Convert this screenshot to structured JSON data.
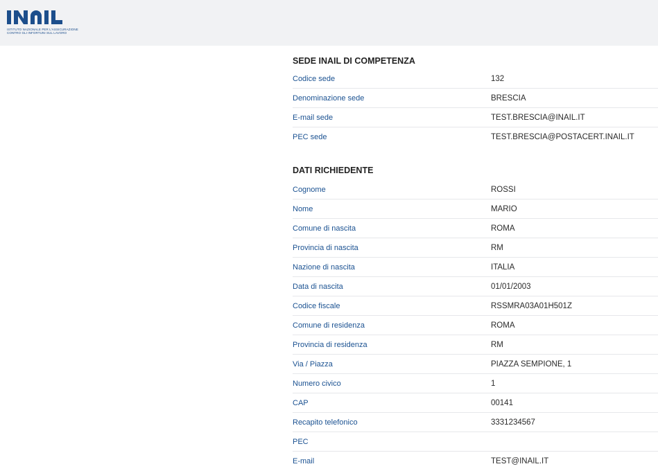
{
  "brand": {
    "logo_text": "INAIL",
    "tagline": "ISTITUTO NAZIONALE PER L'ASSICURAZIONE CONTRO GLI INFORTUNI SUL LAVORO",
    "accent": "#1c4e8c"
  },
  "sede": {
    "title": "SEDE INAIL DI COMPETENZA",
    "rows": [
      {
        "label": "Codice sede",
        "value": "132"
      },
      {
        "label": "Denominazione sede",
        "value": "BRESCIA"
      },
      {
        "label": "E-mail sede",
        "value": "TEST.BRESCIA@INAIL.IT"
      },
      {
        "label": "PEC sede",
        "value": "TEST.BRESCIA@POSTACERT.INAIL.IT"
      }
    ]
  },
  "richiedente": {
    "title": "DATI RICHIEDENTE",
    "rows": [
      {
        "label": "Cognome",
        "value": "ROSSI"
      },
      {
        "label": "Nome",
        "value": "MARIO"
      },
      {
        "label": "Comune di nascita",
        "value": "ROMA"
      },
      {
        "label": "Provincia di nascita",
        "value": "RM"
      },
      {
        "label": "Nazione di nascita",
        "value": "ITALIA"
      },
      {
        "label": "Data di nascita",
        "value": "01/01/2003"
      },
      {
        "label": "Codice fiscale",
        "value": "RSSMRA03A01H501Z"
      },
      {
        "label": "Comune di residenza",
        "value": "ROMA"
      },
      {
        "label": "Provincia di residenza",
        "value": "RM"
      },
      {
        "label": "Via / Piazza",
        "value": "PIAZZA SEMPIONE, 1"
      },
      {
        "label": "Numero civico",
        "value": "1"
      },
      {
        "label": "CAP",
        "value": "00141"
      },
      {
        "label": "Recapito telefonico",
        "value": "3331234567"
      },
      {
        "label": "PEC",
        "value": ""
      },
      {
        "label": "E-mail",
        "value": "TEST@INAIL.IT"
      }
    ]
  }
}
